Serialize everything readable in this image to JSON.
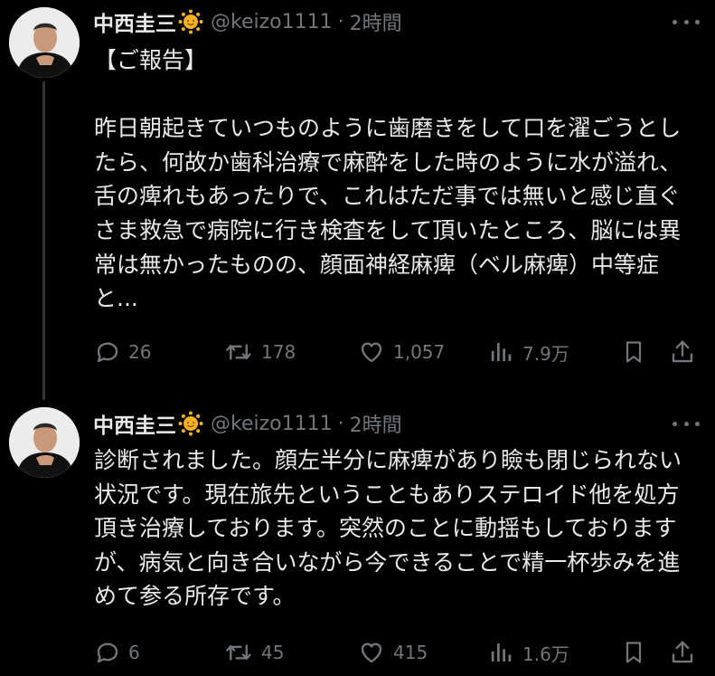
{
  "tweets": [
    {
      "name": "中西圭三",
      "handle": "@keizo1111",
      "sep": "·",
      "time": "2時間",
      "text": "【ご報告】\n\n昨日朝起きていつものように歯磨きをして口を濯ごうとしたら、何故か歯科治療で麻酔をした時のように水が溢れ、舌の痺れもあったりで、これはただ事では無いと感じ直ぐさま救急で病院に行き検査をして頂いたところ、脳には異常は無かったものの、顔面神経麻痺（ベル麻痺）中等症と...",
      "replies": "26",
      "retweets": "178",
      "likes": "1,057",
      "views": "7.9万",
      "icons": [
        "avatar",
        "sun-emoji-icon",
        "more-icon",
        "reply-icon",
        "retweet-icon",
        "like-icon",
        "views-icon",
        "bookmark-icon",
        "share-icon"
      ]
    },
    {
      "name": "中西圭三",
      "handle": "@keizo1111",
      "sep": "·",
      "time": "2時間",
      "text": "診断されました。顔左半分に麻痺があり瞼も閉じられない状況です。現在旅先ということもありステロイド他を処方頂き治療しております。突然のことに動揺もしておりますが、病気と向き合いながら今できることで精一杯歩みを進めて参る所存です。",
      "replies": "6",
      "retweets": "45",
      "likes": "415",
      "views": "1.6万"
    }
  ],
  "colors": {
    "background": "#000000",
    "text": "#e7e9ea",
    "secondary": "#71767b",
    "thread_line": "#333639"
  }
}
